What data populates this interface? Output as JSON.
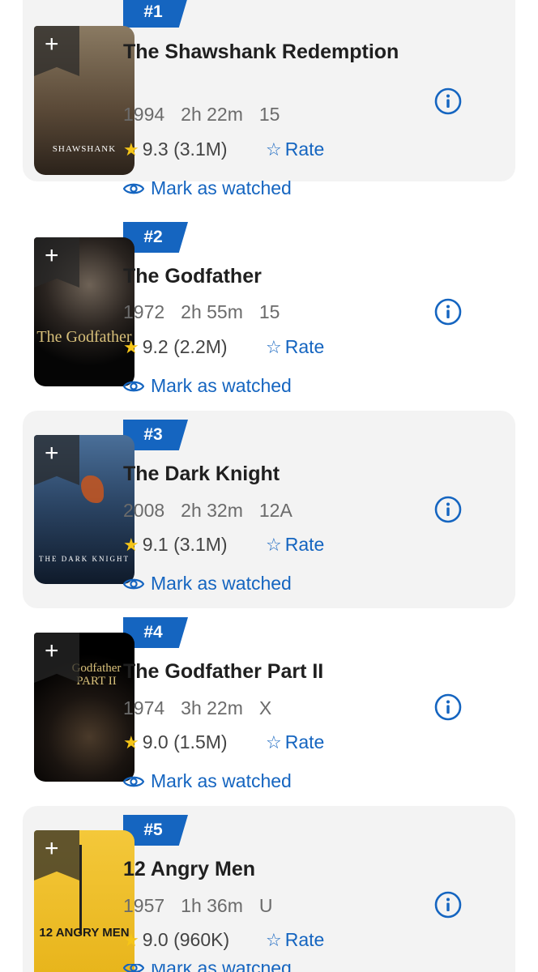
{
  "items": [
    {
      "rank": "#1",
      "title": "The Shawshank Redemption",
      "year": "1994",
      "runtime": "2h 22m",
      "cert": "15",
      "rating": "9.3 (3.1M)",
      "rate_label": "Rate",
      "watched_label": "Mark as watched",
      "poster_text": "SHAWSHANK",
      "poster_colors": [
        "#7a6a55",
        "#3b2f24"
      ]
    },
    {
      "rank": "#2",
      "title": "The Godfather",
      "year": "1972",
      "runtime": "2h 55m",
      "cert": "15",
      "rating": "9.2 (2.2M)",
      "rate_label": "Rate",
      "watched_label": "Mark as watched",
      "poster_text": "The Godfather",
      "poster_colors": [
        "#2a2a2a",
        "#050505"
      ]
    },
    {
      "rank": "#3",
      "title": "The Dark Knight",
      "year": "2008",
      "runtime": "2h 32m",
      "cert": "12A",
      "rating": "9.1 (3.1M)",
      "rate_label": "Rate",
      "watched_label": "Mark as watched",
      "poster_text": "THE DARK KNIGHT",
      "poster_colors": [
        "#3d5f86",
        "#0f1a2a"
      ]
    },
    {
      "rank": "#4",
      "title": "The Godfather Part II",
      "year": "1974",
      "runtime": "3h 22m",
      "cert": "X",
      "rating": "9.0 (1.5M)",
      "rate_label": "Rate",
      "watched_label": "Mark as watched",
      "poster_text": "Godfather PART II",
      "poster_colors": [
        "#1a1a1a",
        "#000000"
      ]
    },
    {
      "rank": "#5",
      "title": "12 Angry Men",
      "year": "1957",
      "runtime": "1h 36m",
      "cert": "U",
      "rating": "9.0 (960K)",
      "rate_label": "Rate",
      "watched_label": "Mark as watched",
      "poster_text": "12 ANGRY MEN",
      "poster_colors": [
        "#f2c230",
        "#d9a514"
      ]
    }
  ],
  "colors": {
    "accent": "#1565c0",
    "star": "#f5c518",
    "card": "#f3f3f3"
  }
}
